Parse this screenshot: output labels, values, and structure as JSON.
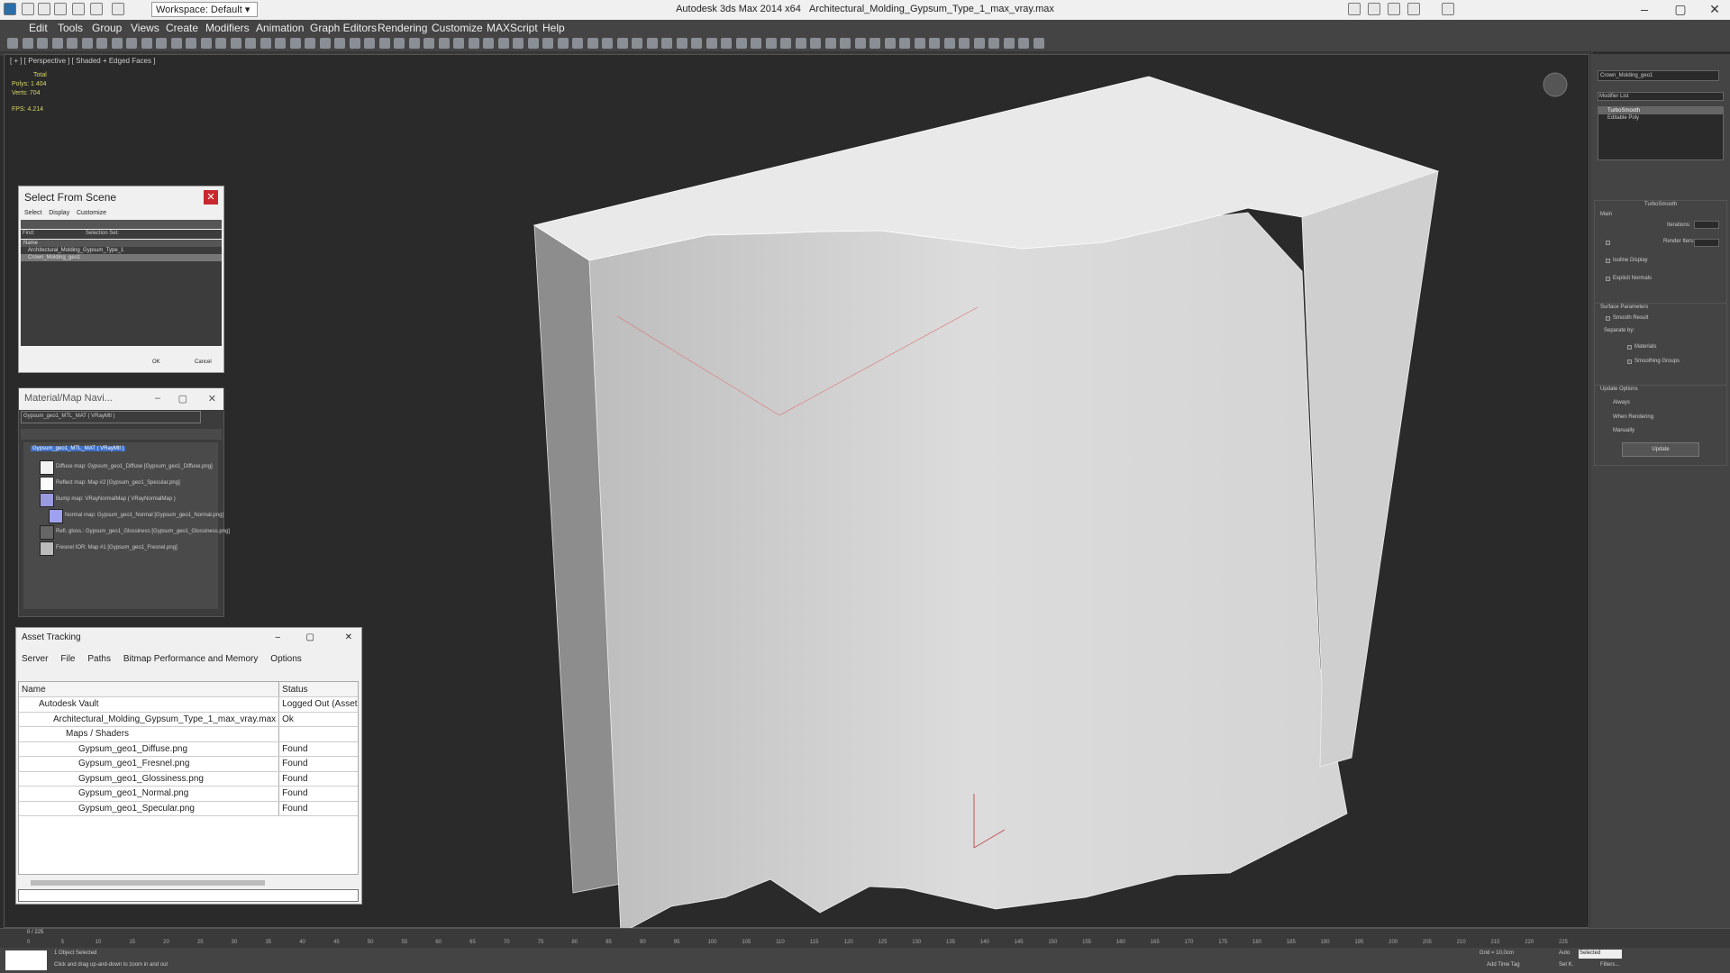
{
  "titlebar": {
    "app": "Autodesk 3ds Max  2014 x64",
    "file": "Architectural_Molding_Gypsum_Type_1_max_vray.max",
    "workspace": "Workspace: Default"
  },
  "menu": [
    "Edit",
    "Tools",
    "Group",
    "Views",
    "Create",
    "Modifiers",
    "Animation",
    "Graph Editors",
    "Rendering",
    "Customize",
    "MAXScript",
    "Help"
  ],
  "viewport": {
    "label": "[ + ] [ Perspective ] [ Shaded + Edged Faces ]",
    "stats_total": "Total",
    "stats_polys": "Polys:  1 404",
    "stats_verts": "Verts:   704",
    "stats_fps": "FPS:    4.214"
  },
  "select_scene": {
    "title": "Select From Scene",
    "menu": [
      "Select",
      "Display",
      "Customize"
    ],
    "find_label": "Find:",
    "selection_set_label": "Selection Set:",
    "col_name": "Name",
    "items": [
      "Architectural_Molding_Gypsum_Type_1",
      "Crown_Molding_geo1"
    ],
    "ok": "OK",
    "cancel": "Cancel"
  },
  "material_nav": {
    "title": "Material/Map Navi...",
    "field": "Gypsum_geo1_MTL_MAT  ( VRayMtl )",
    "root": "Gypsum_geo1_MTL_MAT  ( VRayMtl )",
    "items": [
      "Diffuse map: Gypsum_geo1_Diffuse [Gypsum_geo1_Diffuse.png]",
      "Reflect map: Map #2 [Gypsum_geo1_Specular.png]",
      "Bump map: VRayNormalMap  ( VRayNormalMap )",
      "Normal map: Gypsum_geo1_Normal [Gypsum_geo1_Normal.png]",
      "Refl. gloss.: Gypsum_geo1_Glossiness [Gypsum_geo1_Glossiness.png]",
      "Fresnel IOR: Map #1 [Gypsum_geo1_Fresnel.png]"
    ]
  },
  "asset_tracking": {
    "title": "Asset Tracking",
    "menu": [
      "Server",
      "File",
      "Paths",
      "Bitmap Performance and Memory",
      "Options"
    ],
    "col_name": "Name",
    "col_status": "Status",
    "rows": [
      {
        "name": "Autodesk Vault",
        "status": "Logged Out (Asset"
      },
      {
        "name": "Architectural_Molding_Gypsum_Type_1_max_vray.max",
        "status": "Ok"
      },
      {
        "name": "Maps / Shaders",
        "status": ""
      },
      {
        "name": "Gypsum_geo1_Diffuse.png",
        "status": "Found"
      },
      {
        "name": "Gypsum_geo1_Fresnel.png",
        "status": "Found"
      },
      {
        "name": "Gypsum_geo1_Glossiness.png",
        "status": "Found"
      },
      {
        "name": "Gypsum_geo1_Normal.png",
        "status": "Found"
      },
      {
        "name": "Gypsum_geo1_Specular.png",
        "status": "Found"
      }
    ]
  },
  "cmd": {
    "object_name": "Crown_Molding_geo1",
    "modifier_list": "Modifier List",
    "stack": [
      "TurboSmooth",
      "Editable Poly"
    ],
    "rollout_title": "TurboSmooth",
    "main": "Main",
    "iterations": "Iterations:",
    "render_iters": "Render Iters:",
    "isoline": "Isoline Display",
    "explicit": "Explicit Normals",
    "surface": "Surface Parameters",
    "smooth_result": "Smooth Result",
    "separate_by": "Separate by:",
    "materials": "Materials",
    "smoothing_groups": "Smoothing Groups",
    "update_options": "Update Options",
    "always": "Always",
    "when_rendering": "When Rendering",
    "manually": "Manually",
    "update": "Update"
  },
  "timeline": {
    "frame": "0 / 225",
    "ticks": [
      "0",
      "5",
      "10",
      "15",
      "20",
      "25",
      "30",
      "35",
      "40",
      "45",
      "50",
      "55",
      "60",
      "65",
      "70",
      "75",
      "80",
      "85",
      "90",
      "95",
      "100",
      "105",
      "110",
      "115",
      "120",
      "125",
      "130",
      "135",
      "140",
      "145",
      "150",
      "155",
      "160",
      "165",
      "170",
      "175",
      "180",
      "185",
      "190",
      "195",
      "200",
      "205",
      "210",
      "215",
      "220",
      "225"
    ]
  },
  "status": {
    "selected": "1 Object Selected",
    "hint": "Click and drag up-and-down to zoom in and out",
    "grid": "Grid = 10,0cm",
    "auto": "Auto",
    "set_key": "Set K.",
    "selected_dd": "Selected",
    "filters": "Filters...",
    "add_time_tag": "Add Time Tag"
  }
}
